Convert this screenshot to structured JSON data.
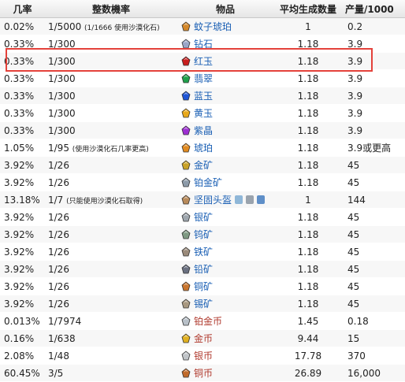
{
  "table": {
    "headers": {
      "rate": "几率",
      "chance": "整数機率",
      "item": "物品",
      "avg": "平均生成数量",
      "yield": "产量/1000"
    },
    "rows": [
      {
        "rate": "0.02%",
        "chance": "1/5000",
        "note": "(1/1666 使用沙漠化石)",
        "item": "蚊子琥珀",
        "icon": "amber-mosquito-icon",
        "icon_color": "#d4882a",
        "avg": "1",
        "yield": "0.2"
      },
      {
        "rate": "0.33%",
        "chance": "1/300",
        "note": "",
        "item": "钻石",
        "icon": "diamond-icon",
        "icon_color": "#9aa6c8",
        "avg": "1.18",
        "yield": "3.9"
      },
      {
        "rate": "0.33%",
        "chance": "1/300",
        "note": "",
        "item": "红玉",
        "icon": "ruby-icon",
        "icon_color": "#c81e1e",
        "avg": "1.18",
        "yield": "3.9"
      },
      {
        "rate": "0.33%",
        "chance": "1/300",
        "note": "",
        "item": "翡翠",
        "icon": "emerald-icon",
        "icon_color": "#1fa04a",
        "avg": "1.18",
        "yield": "3.9"
      },
      {
        "rate": "0.33%",
        "chance": "1/300",
        "note": "",
        "item": "蓝玉",
        "icon": "sapphire-icon",
        "icon_color": "#1f55d6",
        "avg": "1.18",
        "yield": "3.9"
      },
      {
        "rate": "0.33%",
        "chance": "1/300",
        "note": "",
        "item": "黄玉",
        "icon": "topaz-icon",
        "icon_color": "#e8a81a",
        "avg": "1.18",
        "yield": "3.9"
      },
      {
        "rate": "0.33%",
        "chance": "1/300",
        "note": "",
        "item": "紫晶",
        "icon": "amethyst-icon",
        "icon_color": "#9d2fd2",
        "avg": "1.18",
        "yield": "3.9"
      },
      {
        "rate": "1.05%",
        "chance": "1/95",
        "note": "(使用沙漠化石几率更高)",
        "item": "琥珀",
        "icon": "amber-icon",
        "icon_color": "#e08a20",
        "avg": "1.18",
        "yield": "3.9或更高"
      },
      {
        "rate": "3.92%",
        "chance": "1/26",
        "note": "",
        "item": "金矿",
        "icon": "gold-ore-icon",
        "icon_color": "#c9a227",
        "avg": "1.18",
        "yield": "45"
      },
      {
        "rate": "3.92%",
        "chance": "1/26",
        "note": "",
        "item": "铂金矿",
        "icon": "platinum-ore-icon",
        "icon_color": "#8c9aa8",
        "avg": "1.18",
        "yield": "45"
      },
      {
        "rate": "13.18%",
        "chance": "1/7",
        "note": "(只能使用沙漠化石取得)",
        "item": "坚固头盔",
        "icon": "fossil-helmet-icon",
        "icon_color": "#b88a5a",
        "avg": "1",
        "yield": "144",
        "extra_icons": [
          "pc-icon",
          "console-icon",
          "mobile-icon"
        ]
      },
      {
        "rate": "3.92%",
        "chance": "1/26",
        "note": "",
        "item": "银矿",
        "icon": "silver-ore-icon",
        "icon_color": "#9ea6ad",
        "avg": "1.18",
        "yield": "45"
      },
      {
        "rate": "3.92%",
        "chance": "1/26",
        "note": "",
        "item": "钨矿",
        "icon": "tungsten-ore-icon",
        "icon_color": "#7f9a83",
        "avg": "1.18",
        "yield": "45"
      },
      {
        "rate": "3.92%",
        "chance": "1/26",
        "note": "",
        "item": "铁矿",
        "icon": "iron-ore-icon",
        "icon_color": "#9a8a7a",
        "avg": "1.18",
        "yield": "45"
      },
      {
        "rate": "3.92%",
        "chance": "1/26",
        "note": "",
        "item": "铅矿",
        "icon": "lead-ore-icon",
        "icon_color": "#6a7080",
        "avg": "1.18",
        "yield": "45"
      },
      {
        "rate": "3.92%",
        "chance": "1/26",
        "note": "",
        "item": "铜矿",
        "icon": "copper-ore-icon",
        "icon_color": "#c9752e",
        "avg": "1.18",
        "yield": "45"
      },
      {
        "rate": "3.92%",
        "chance": "1/26",
        "note": "",
        "item": "锡矿",
        "icon": "tin-ore-icon",
        "icon_color": "#a89880",
        "avg": "1.18",
        "yield": "45"
      },
      {
        "rate": "0.013%",
        "chance": "1/7974",
        "note": "",
        "item": "铂金币",
        "icon": "platinum-coin-icon",
        "icon_color": "#b8c0c8",
        "avg": "1.45",
        "yield": "0.18",
        "red": true
      },
      {
        "rate": "0.16%",
        "chance": "1/638",
        "note": "",
        "item": "金币",
        "icon": "gold-coin-icon",
        "icon_color": "#e0b020",
        "avg": "9.44",
        "yield": "15",
        "red": true
      },
      {
        "rate": "2.08%",
        "chance": "1/48",
        "note": "",
        "item": "银币",
        "icon": "silver-coin-icon",
        "icon_color": "#c0c4c8",
        "avg": "17.78",
        "yield": "370",
        "red": true
      },
      {
        "rate": "60.45%",
        "chance": "3/5",
        "note": "",
        "item": "铜币",
        "icon": "copper-coin-icon",
        "icon_color": "#c06a2a",
        "avg": "26.89",
        "yield": "16,000",
        "red": true
      }
    ]
  }
}
